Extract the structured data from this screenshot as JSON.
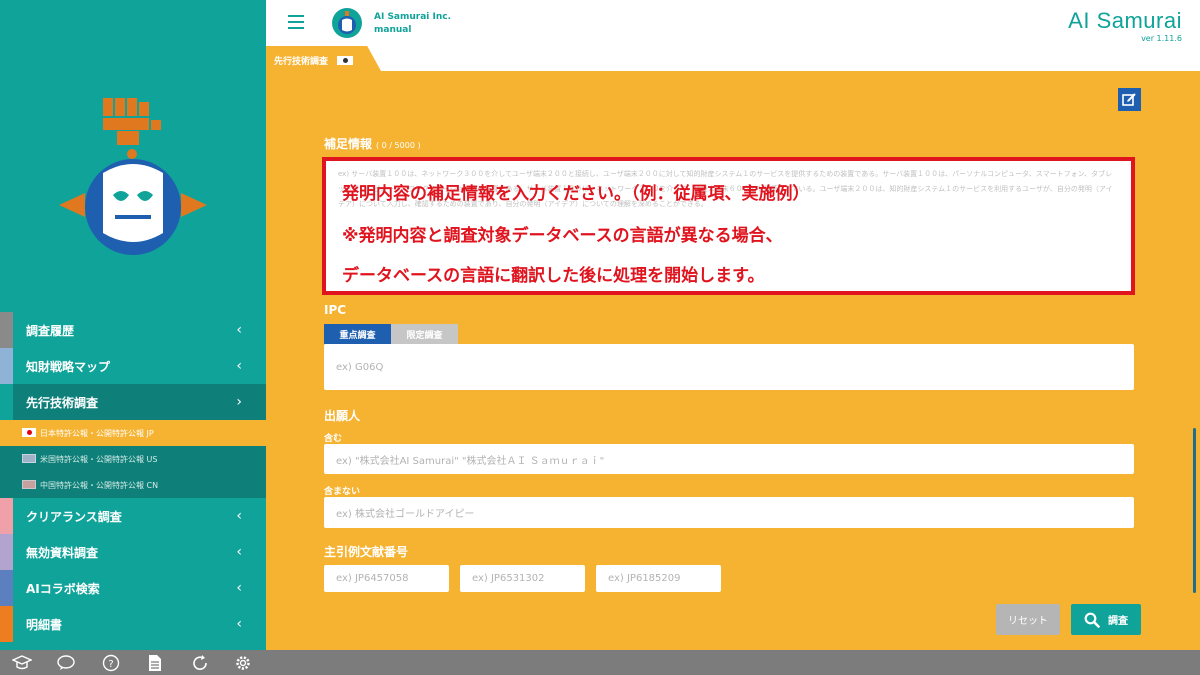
{
  "header": {
    "company": "AI Samurai Inc.",
    "user": "manual",
    "brand": "AI Samurai",
    "version": "ver 1.11.6"
  },
  "tab": {
    "label": "先行技術調査"
  },
  "sidebar": {
    "items": [
      {
        "label": "調査履歴",
        "chevron": "‹",
        "mark_color": "#8a8a8a"
      },
      {
        "label": "知財戦略マップ",
        "chevron": "‹",
        "mark_color": "#8fb3d6"
      },
      {
        "label": "先行技術調査",
        "chevron": "›",
        "mark_color": "#10a39a"
      },
      {
        "label": "クリアランス調査",
        "chevron": "‹",
        "mark_color": "#f0a0a8"
      },
      {
        "label": "無効資料調査",
        "chevron": "‹",
        "mark_color": "#b3a4cf"
      },
      {
        "label": "AIコラボ検索",
        "chevron": "‹",
        "mark_color": "#5b7fbf"
      },
      {
        "label": "明細書",
        "chevron": "‹",
        "mark_color": "#ee7d22"
      }
    ],
    "subitems": [
      {
        "label": "日本特許公報・公開特許公報 JP"
      },
      {
        "label": "米国特許公報・公開特許公報 US"
      },
      {
        "label": "中国特許公報・公開特許公報 CN"
      }
    ]
  },
  "form": {
    "supplement": {
      "label": "補足情報",
      "count": "( 0 / 5000 )",
      "placeholder": "ex) サーバ装置１００は、ネットワーク３００を介してユーザ端末２００と接続し、ユーザ端末２００に対して知的財産システム１のサービスを提供するための装置である。サーバ装置１００は、パーソナルコンピュータ、スマートフォン、タブレット型コンピュータ、ワークステーション等の装置である。サーバ装置１００は、ネットワーク３００を介して、代理人端末６００とも接続されている。ユーザ端末２００は、知的財産システム１のサービスを利用するユーザが、自分の発明（アイデア）について入力し、確認するための装置であり、自分の発明（アイデア）についての理解を深めることができる。"
    },
    "ipc": {
      "label": "IPC",
      "tabs": [
        "重点調査",
        "限定調査"
      ],
      "placeholder": "ex) G06Q"
    },
    "applicant": {
      "label": "出願人",
      "include_label": "含む",
      "include_placeholder": "ex) \"株式会社AI Samurai\" \"株式会社ＡＩ Ｓａｍｕｒａｉ\"",
      "exclude_label": "含まない",
      "exclude_placeholder": "ex) 株式会社ゴールドアイピー"
    },
    "citations": {
      "label": "主引例文献番号",
      "placeholders": [
        "ex) JP6457058",
        "ex) JP6531302",
        "ex) JP6185209"
      ]
    },
    "reset_label": "リセット",
    "search_label": "調査"
  },
  "annotation": {
    "line1": "発明内容の補足情報を入力ください。（例：従属項、実施例）",
    "line2": "※発明内容と調査対象データベースの言語が異なる場合、",
    "line3": "データベースの言語に翻訳した後に処理を開始します。"
  },
  "bottombar": {
    "icons": [
      "graduation-cap-icon",
      "faq-icon",
      "help-icon",
      "document-icon",
      "sync-icon",
      "settings-icon"
    ],
    "faq_text": "FAQ",
    "help_text": "?"
  },
  "colors": {
    "teal": "#10a39a",
    "orange": "#f6b331",
    "red": "#e0141e",
    "blue": "#1f5fb0"
  }
}
